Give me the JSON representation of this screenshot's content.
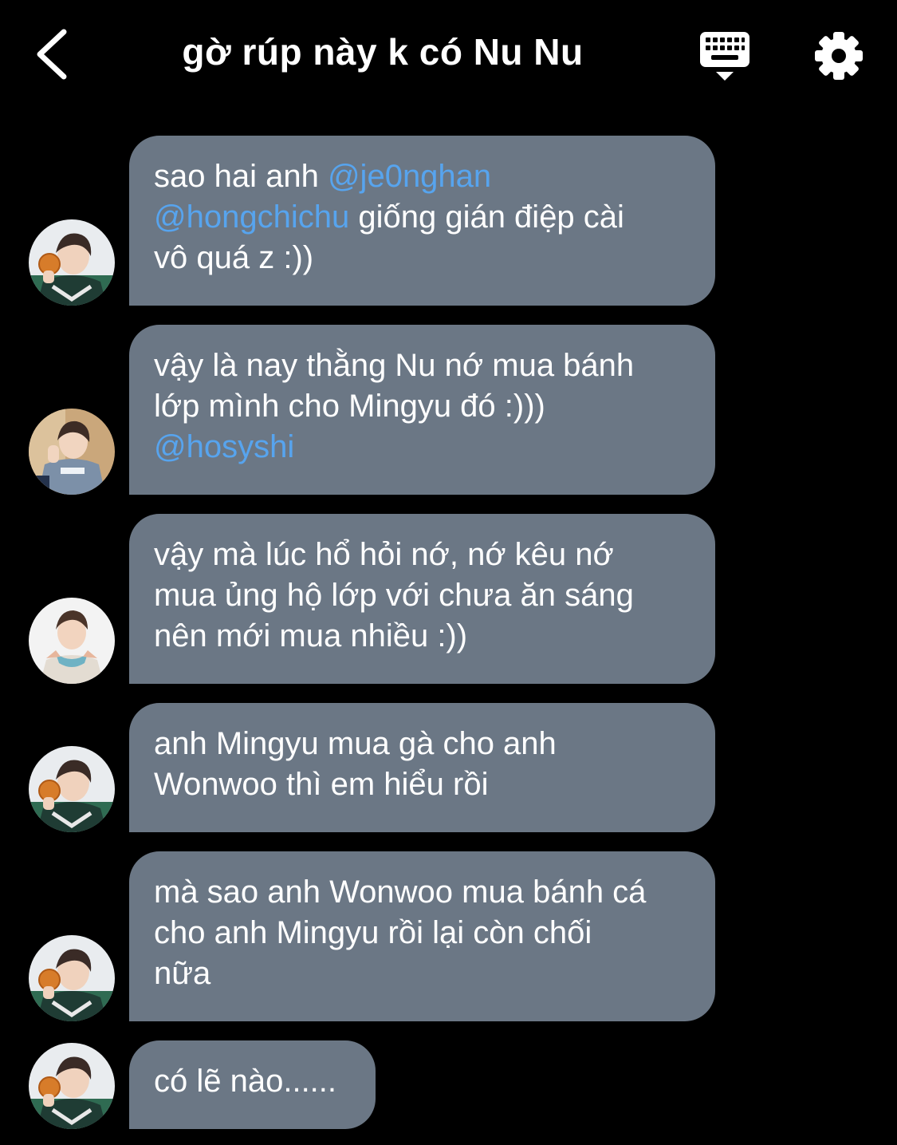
{
  "header": {
    "title": "gờ rúp này k có Nu Nu",
    "back_icon": "chevron-left-icon",
    "keyboard_icon": "keyboard-hide-icon",
    "settings_icon": "gear-icon"
  },
  "colors": {
    "background": "#000000",
    "bubble": "#6b7785",
    "mention": "#57a4ee",
    "text": "#ffffff"
  },
  "messages": [
    {
      "avatar": "avatar-orange-hoodie",
      "parts": [
        {
          "text": "sao hai anh "
        },
        {
          "text": "@je0nghan",
          "mention": true
        },
        {
          "text": "\n"
        },
        {
          "text": "@hongchichu",
          "mention": true
        },
        {
          "text": " giống gián điệp cài\nvô quá z :))"
        }
      ]
    },
    {
      "avatar": "avatar-grey-hoodie",
      "parts": [
        {
          "text": "vậy là nay thằng Nu nớ mua bánh\nlớp mình cho Mingyu đó :)))\n"
        },
        {
          "text": "@hosyshi",
          "mention": true
        }
      ]
    },
    {
      "avatar": "avatar-scarf",
      "parts": [
        {
          "text": "vậy mà lúc hổ hỏi nớ, nớ kêu nớ\nmua ủng hộ lớp với chưa ăn sáng\nnên mới mua nhiều :))"
        }
      ]
    },
    {
      "avatar": "avatar-orange-hoodie",
      "parts": [
        {
          "text": "anh Mingyu mua gà cho anh\nWonwoo thì em hiểu rồi"
        }
      ]
    },
    {
      "avatar": "avatar-orange-hoodie",
      "parts": [
        {
          "text": "mà sao anh Wonwoo mua bánh cá\ncho anh Mingyu rồi lại còn chối\nnữa"
        }
      ]
    },
    {
      "avatar": "avatar-orange-hoodie",
      "parts": [
        {
          "text": "có lẽ nào......"
        }
      ]
    }
  ]
}
